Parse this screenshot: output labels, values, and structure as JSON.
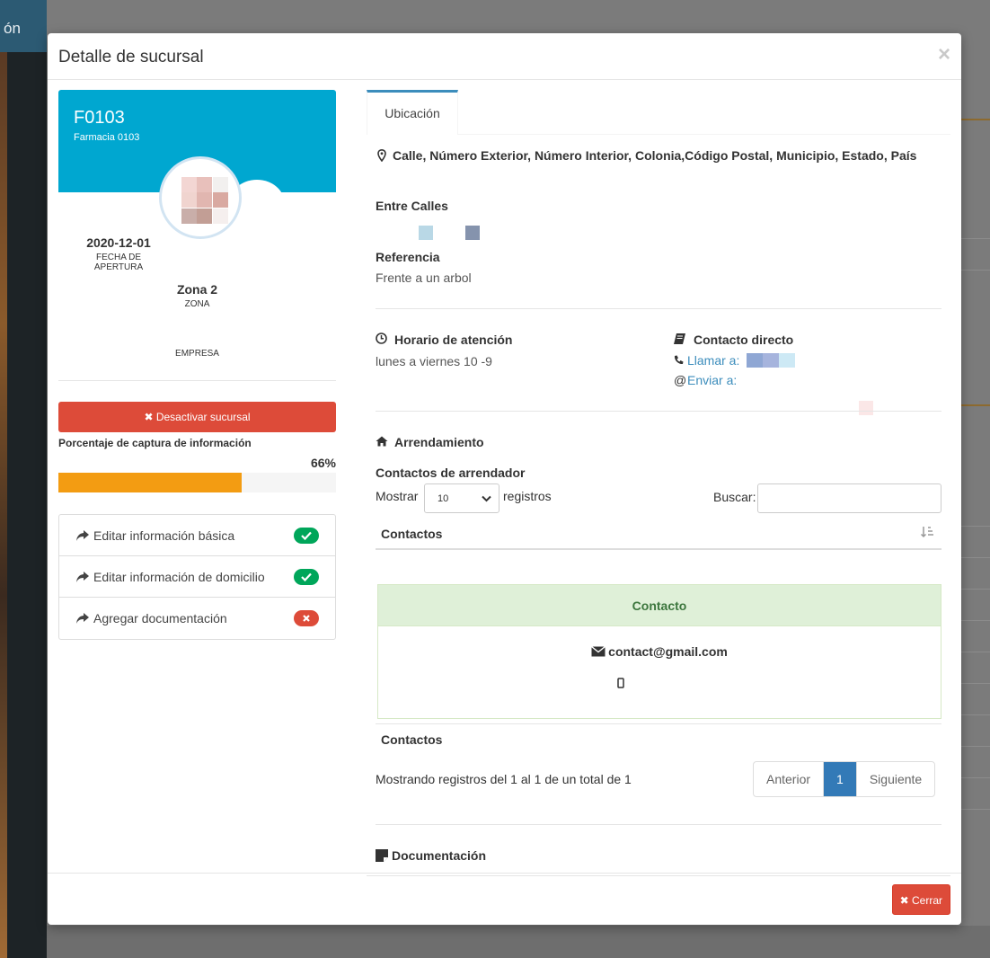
{
  "background": {
    "topbar_text": "ón"
  },
  "modal": {
    "title": "Detalle de sucursal",
    "close_symbol": "×"
  },
  "widget": {
    "code": "F0103",
    "name": "Farmacia 0103",
    "opening_date": "2020-12-01",
    "opening_label": "FECHA DE APERTURA",
    "zone_value": "Zona 2",
    "zone_label": "ZONA",
    "company_label": "EMPRESA"
  },
  "actions": {
    "deactivate": "✖ Desactivar sucursal",
    "progress_label": "Porcentaje de captura de información",
    "progress_pct": "66%",
    "progress_value": 66
  },
  "tasks": [
    {
      "label": "Editar información básica",
      "status": "done"
    },
    {
      "label": "Editar información de domicilio",
      "status": "done"
    },
    {
      "label": "Agregar documentación",
      "status": "missing"
    }
  ],
  "tabs": {
    "location": "Ubicación"
  },
  "location": {
    "address": "Calle, Número Exterior, Número Interior, Colonia,Código Postal, Municipio, Estado, País",
    "between_streets_label": "Entre Calles",
    "reference_label": "Referencia",
    "reference_value": "Frente a un arbol",
    "hours_label": "Horario de atención",
    "hours_value": "lunes a viernes 10 -9",
    "contact_label": "Contacto directo",
    "call_label": "Llamar a:",
    "email_label": "Enviar a:"
  },
  "lease": {
    "title": "Arrendamiento",
    "contacts_title": "Contactos de arrendador",
    "show_label": "Mostrar",
    "page_size": "10",
    "records_label": "registros",
    "search_label": "Buscar:",
    "column_header": "Contactos",
    "contact_card_title": "Contacto",
    "contact_email": "contact@gmail.com",
    "footer_header": "Contactos",
    "showing_text": "Mostrando registros del 1 al 1 de un total de 1",
    "pager_prev": "Anterior",
    "pager_current": "1",
    "pager_next": "Siguiente"
  },
  "documents": {
    "title": "Documentación"
  },
  "footer": {
    "close": "✖ Cerrar"
  },
  "colors": {
    "primary": "#3c8dbc",
    "danger": "#dd4b39",
    "success": "#00a65a",
    "warning": "#f39c12",
    "aqua": "#00a7d0"
  }
}
